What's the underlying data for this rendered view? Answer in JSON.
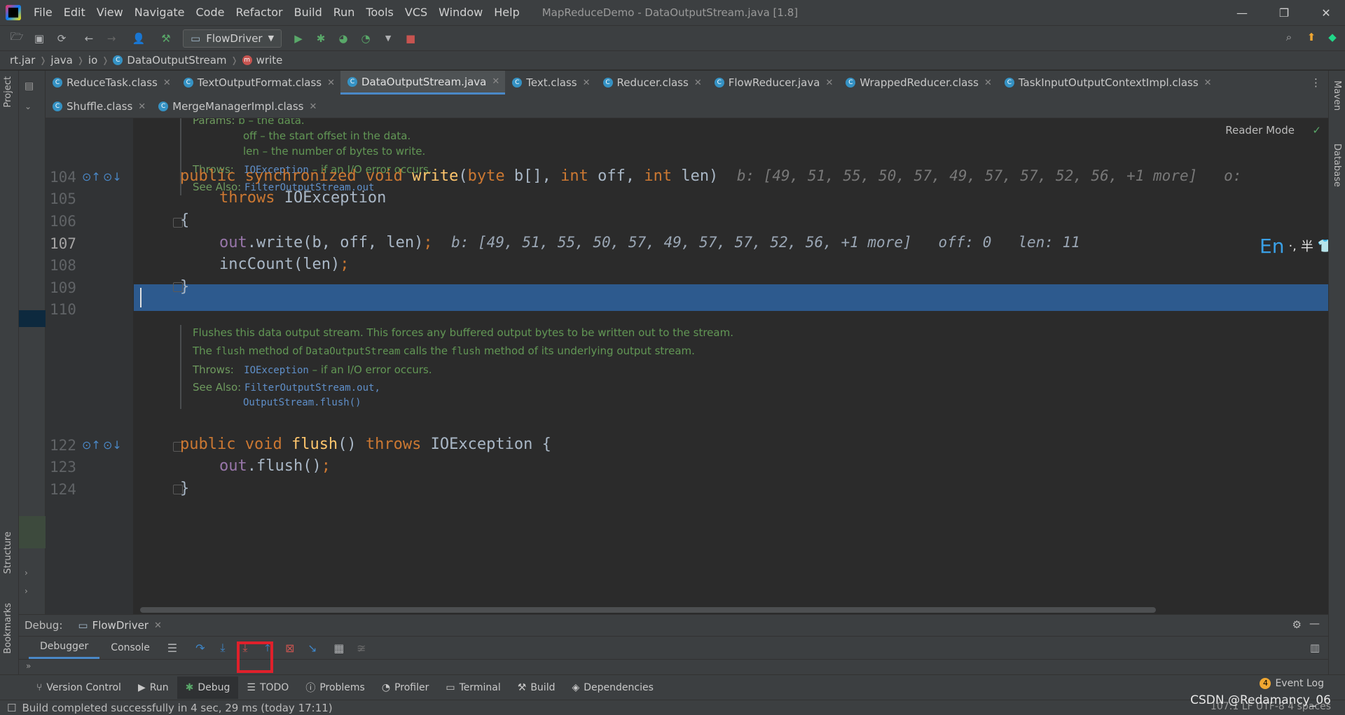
{
  "window": {
    "title": "MapReduceDemo - DataOutputStream.java [1.8]",
    "menu": [
      "File",
      "Edit",
      "View",
      "Navigate",
      "Code",
      "Refactor",
      "Build",
      "Run",
      "Tools",
      "VCS",
      "Window",
      "Help"
    ]
  },
  "toolbar": {
    "run_config": "FlowDriver"
  },
  "breadcrumb": [
    "rt.jar",
    "java",
    "io",
    "DataOutputStream",
    "write"
  ],
  "tabs_row1": [
    {
      "label": "ReduceTask.class"
    },
    {
      "label": "TextOutputFormat.class"
    },
    {
      "label": "DataOutputStream.java",
      "active": true
    },
    {
      "label": "Text.class"
    },
    {
      "label": "Reducer.class"
    },
    {
      "label": "FlowReducer.java"
    },
    {
      "label": "WrappedReducer.class"
    },
    {
      "label": "TaskInputOutputContextImpl.class"
    }
  ],
  "tabs_row2": [
    {
      "label": "Shuffle.class"
    },
    {
      "label": "MergeManagerImpl.class"
    }
  ],
  "editor": {
    "reader_mode": "Reader Mode",
    "doc1": {
      "params_label": "Params:",
      "p0": "b – the data.",
      "p1": "off – the start offset in the data.",
      "p2": "len – the number of bytes to write.",
      "throws_label": "Throws:",
      "throws_code": "IOException",
      "throws_text": " – if an I/O error occurs.",
      "see_label": "See Also:",
      "see_code": "FilterOutputStream.out"
    },
    "lines": {
      "l104": "104",
      "l105": "105",
      "l106": "106",
      "l107": "107",
      "l108": "108",
      "l109": "109",
      "l110": "110",
      "l122": "122",
      "l123": "123",
      "l124": "124"
    },
    "code": {
      "c104_kw": "public synchronized void ",
      "c104_fn": "write",
      "c104_a": "(",
      "c104_kw2": "byte",
      "c104_b": " b[], ",
      "c104_kw3": "int",
      "c104_c": " off, ",
      "c104_kw4": "int",
      "c104_d": " len)",
      "c104_hint": "b: [49, 51, 55, 50, 57, 49, 57, 57, 52, 56, +1 more]   o:",
      "c105_kw": "throws",
      "c105_b": " IOException",
      "c106": "{",
      "c107_fld": "out",
      "c107_a": ".write(b, off, len)",
      "c107_semi": ";",
      "c107_hint": "b: [49, 51, 55, 50, 57, 49, 57, 57, 52, 56, +1 more]   off: 0   len: 11",
      "c108_a": "incCount(len)",
      "c108_semi": ";",
      "c109": "}",
      "c122_kw": "public void ",
      "c122_fn": "flush",
      "c122_a": "() ",
      "c122_kw2": "throws",
      "c122_b": " IOException {",
      "c123_fld": "out",
      "c123_a": ".flush()",
      "c123_semi": ";",
      "c124": "}"
    },
    "doc2": {
      "t1": "Flushes this data output stream. This forces any buffered output bytes to be written out to the stream.",
      "t2a": "The ",
      "t2b": "flush",
      "t2c": " method of ",
      "t2d": "DataOutputStream",
      "t2e": " calls the ",
      "t2f": "flush",
      "t2g": " method of its underlying output stream.",
      "throws_label": "Throws:",
      "throws_code": "IOException",
      "throws_text": " – if an I/O error occurs.",
      "see_label": "See Also:",
      "see_code1": "FilterOutputStream.out,",
      "see_code2": "OutputStream.flush()"
    },
    "ime": {
      "en": "En",
      "punct": "·,",
      "half": "半"
    }
  },
  "debug": {
    "label": "Debug:",
    "session": "FlowDriver",
    "tabs": [
      "Debugger",
      "Console"
    ]
  },
  "tool_windows": [
    "Version Control",
    "Run",
    "Debug",
    "TODO",
    "Problems",
    "Profiler",
    "Terminal",
    "Build",
    "Dependencies"
  ],
  "right_tools": [
    "Maven",
    "Database"
  ],
  "left_tools": [
    "Project",
    "Structure",
    "Bookmarks"
  ],
  "event_log": {
    "count": "4",
    "label": "Event Log"
  },
  "status": {
    "message": "Build completed successfully in 4 sec, 29 ms (today 17:11)",
    "right": "107:1   LF   UTF-8   4 spaces"
  },
  "watermark": "CSDN @Redamancy_06"
}
